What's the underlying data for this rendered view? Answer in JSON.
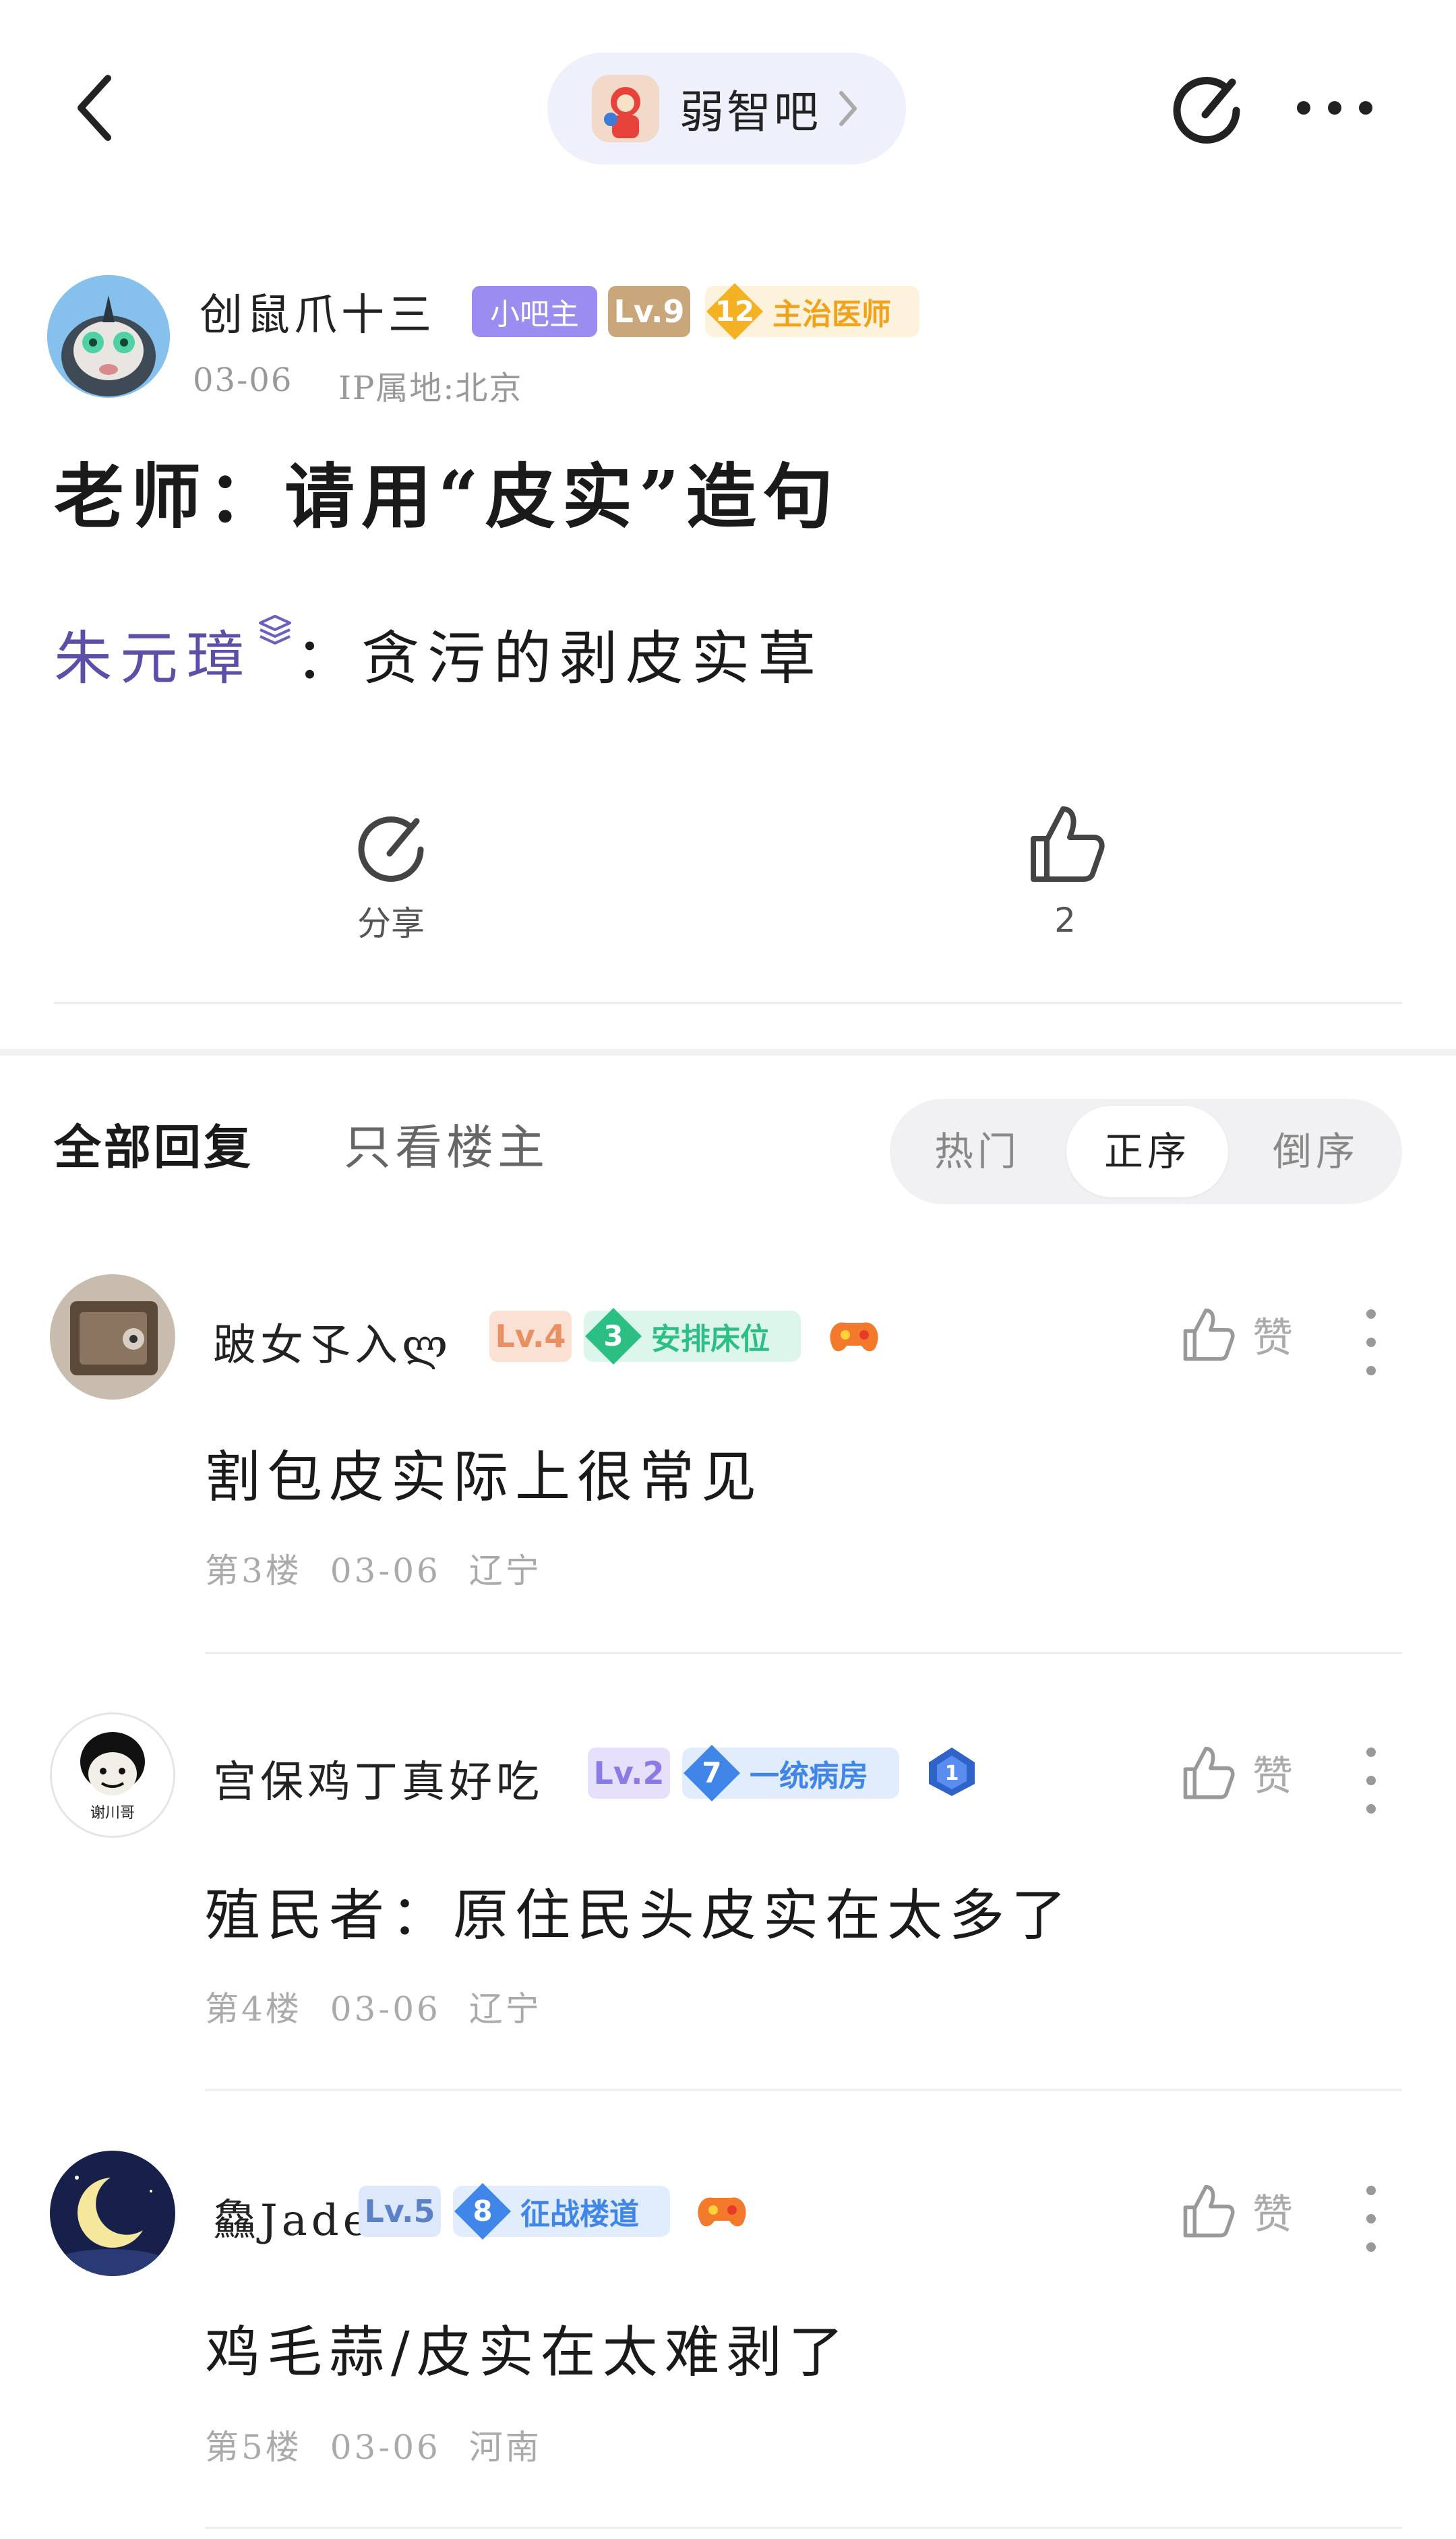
{
  "topbar": {
    "forum_name": "弱智吧"
  },
  "post": {
    "author": "创鼠爪十三",
    "badges": {
      "owner": "小吧主",
      "level": "Lv.9",
      "rank_num": "12",
      "rank_title": "主治医师"
    },
    "date": "03-06",
    "ip": "IP属地:北京",
    "title": "老师：请用“皮实”造句",
    "content_name": "朱元璋",
    "content_rest": "：贪污的剥皮实草",
    "share_label": "分享",
    "like_count": "2"
  },
  "tabs": {
    "all": "全部回复",
    "op_only": "只看楼主",
    "sort": [
      "热门",
      "正序",
      "倒序"
    ],
    "sort_selected": "正序"
  },
  "replies": [
    {
      "username": "跛女孓入ლ",
      "level": "Lv.4",
      "tag_num": "3",
      "tag_title": "安排床位",
      "like_label": "赞",
      "text": "割包皮实际上很常见",
      "floor": "第3楼",
      "date": "03-06",
      "location": "辽宁"
    },
    {
      "username": "宫保鸡丁真好吃",
      "level": "Lv.2",
      "tag_num": "7",
      "tag_title": "一统病房",
      "like_label": "赞",
      "text": "殖民者：原住民头皮实在太多了",
      "floor": "第4楼",
      "date": "03-06",
      "location": "辽宁",
      "avatar_caption": "谢川哥"
    },
    {
      "username": "鱻Jade",
      "level": "Lv.5",
      "tag_num": "8",
      "tag_title": "征战楼道",
      "like_label": "赞",
      "text": "鸡毛蒜/皮实在太难剥了",
      "floor": "第5楼",
      "date": "03-06",
      "location": "河南"
    }
  ],
  "colors": {
    "owner_badge": "#9b8df0",
    "level_badge": "#c9a77a",
    "rank_orange": "#f4a820",
    "tag_green": "#2bbf84",
    "tag_blue": "#3f86e8",
    "username_link": "#5b4fa8"
  }
}
